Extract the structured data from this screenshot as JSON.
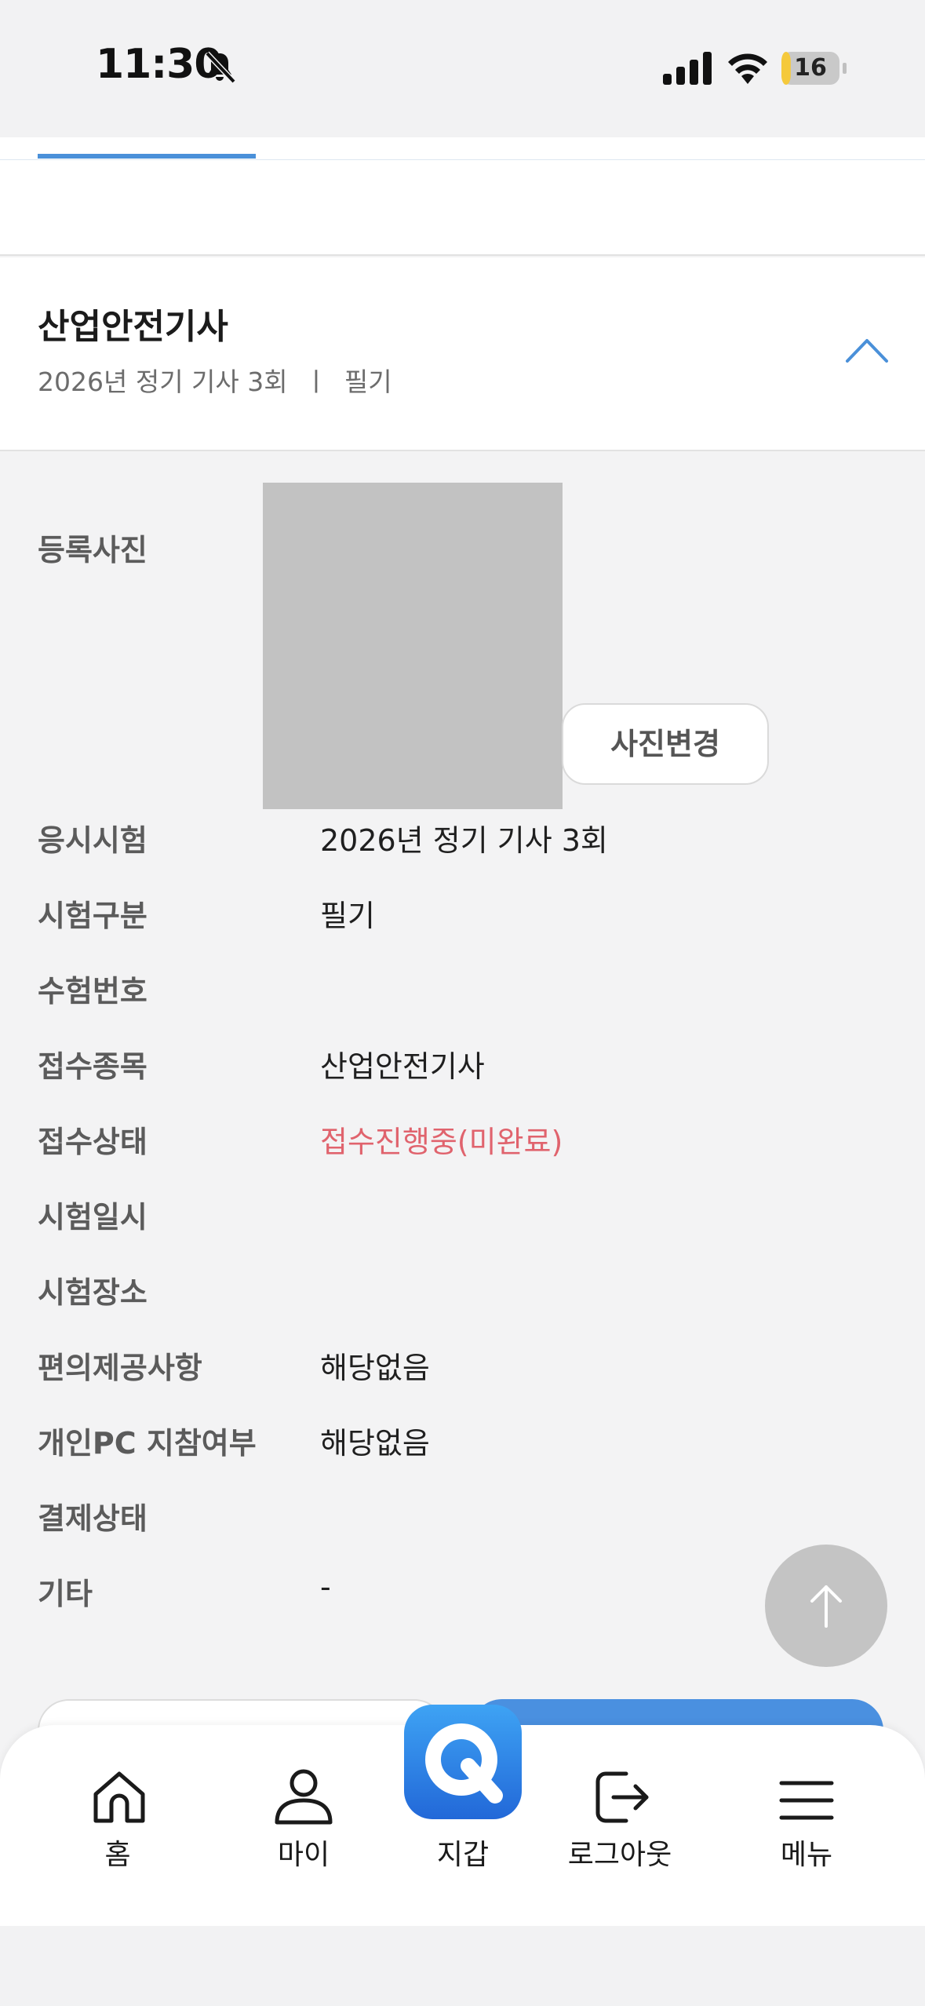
{
  "status_bar": {
    "time": "11:30",
    "battery": "16",
    "battery_level": 0.16
  },
  "card": {
    "title": "산업안전기사",
    "subtitle": "2026년 정기 기사 3회  ㅣ  필기"
  },
  "photo": {
    "label": "등록사진",
    "change_button": "사진변경"
  },
  "rows": [
    {
      "label": "응시시험",
      "value": "2026년 정기 기사 3회"
    },
    {
      "label": "시험구분",
      "value": "필기"
    },
    {
      "label": "수험번호",
      "value": ""
    },
    {
      "label": "접수종목",
      "value": "산업안전기사"
    },
    {
      "label": "접수상태",
      "value": "접수진행중(미완료)"
    },
    {
      "label": "시험일시",
      "value": ""
    },
    {
      "label": "시험장소",
      "value": ""
    },
    {
      "label": "편의제공사항",
      "value": "해당없음"
    },
    {
      "label": "개인PC 지참여부",
      "value": "해당없음"
    },
    {
      "label": "결제상태",
      "value": ""
    },
    {
      "label": "기타",
      "value": "-"
    }
  ],
  "colors": {
    "accent": "#4a90d9",
    "status_red": "#e0636d",
    "wallet_blue": "#2268d8"
  },
  "bottom_nav": {
    "items": [
      {
        "label": "홈",
        "icon": "home-icon"
      },
      {
        "label": "마이",
        "icon": "person-icon"
      },
      {
        "label": "지갑",
        "icon": "wallet-q-icon"
      },
      {
        "label": "로그아웃",
        "icon": "logout-icon"
      },
      {
        "label": "메뉴",
        "icon": "menu-icon"
      }
    ]
  }
}
